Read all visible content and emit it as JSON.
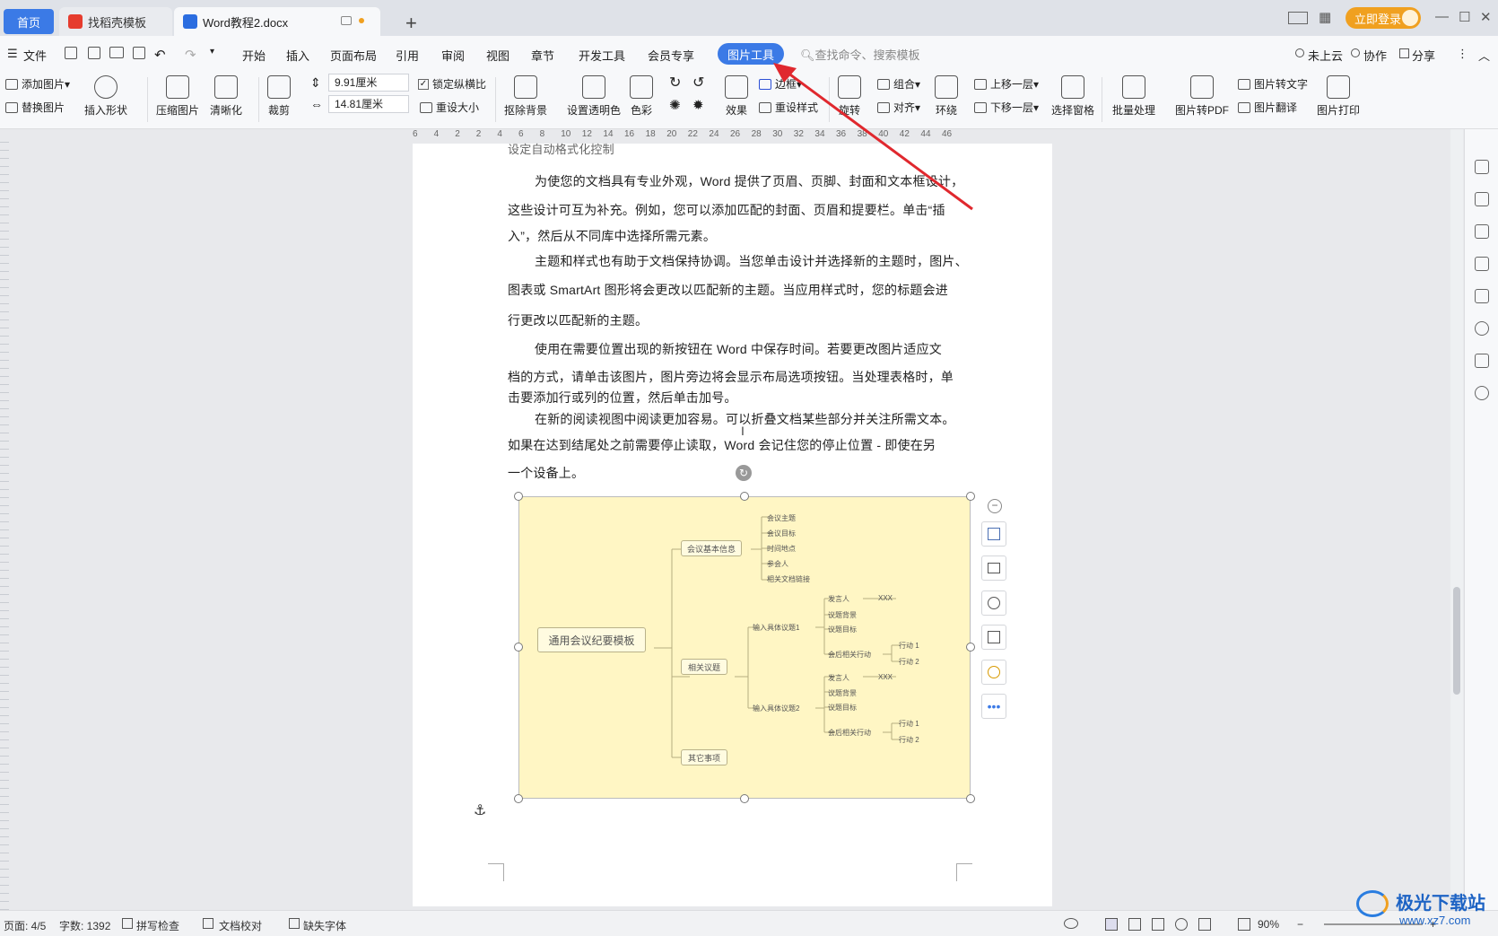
{
  "titlebar": {
    "tabs": [
      {
        "label": "首页"
      },
      {
        "label": "找稻壳模板"
      },
      {
        "label": "Word教程2.docx"
      }
    ],
    "login_label": "立即登录"
  },
  "menubar": {
    "file_label": "文件",
    "items": [
      "开始",
      "插入",
      "页面布局",
      "引用",
      "审阅",
      "视图",
      "章节",
      "开发工具",
      "会员专享"
    ],
    "active_tab": "图片工具",
    "search_placeholder": "查找命令、搜索模板",
    "right_items": [
      "未上云",
      "协作",
      "分享"
    ]
  },
  "ribbon": {
    "add_picture": "添加图片",
    "replace_picture": "替换图片",
    "insert_shape": "插入形状",
    "compress": "压缩图片",
    "sharpen": "清晰化",
    "crop": "裁剪",
    "width_value": "9.91厘米",
    "height_value": "14.81厘米",
    "lock_ratio": "锁定纵横比",
    "reset_size": "重设大小",
    "remove_bg": "抠除背景",
    "set_transparent": "设置透明色",
    "color": "色彩",
    "effects": "效果",
    "border": "边框",
    "reset_style": "重设样式",
    "rotate": "旋转",
    "group": "组合",
    "align": "对齐",
    "wrap": "环绕",
    "bring_forward": "上移一层",
    "send_backward": "下移一层",
    "selection_pane": "选择窗格",
    "batch": "批量处理",
    "to_pdf": "图片转PDF",
    "to_text": "图片转文字",
    "translate": "图片翻译",
    "print": "图片打印"
  },
  "ruler_ticks": [
    "6",
    "4",
    "2",
    "2",
    "4",
    "6",
    "8",
    "10",
    "12",
    "14",
    "16",
    "18",
    "20",
    "22",
    "24",
    "26",
    "28",
    "30",
    "32",
    "34",
    "36",
    "38",
    "40",
    "42",
    "44",
    "46"
  ],
  "document": {
    "partial_top": "设定自动格式化控制",
    "lines": [
      "为使您的文档具有专业外观，Word 提供了页眉、页脚、封面和文本框设计，",
      "这些设计可互为补充。例如，您可以添加匹配的封面、页眉和提要栏。单击“插",
      "入”，然后从不同库中选择所需元素。",
      "主题和样式也有助于文档保持协调。当您单击设计并选择新的主题时，图片、",
      "图表或 SmartArt 图形将会更改以匹配新的主题。当应用样式时，您的标题会进",
      "行更改以匹配新的主题。",
      "使用在需要位置出现的新按钮在 Word 中保存时间。若要更改图片适应文",
      "档的方式，请单击该图片，图片旁边将会显示布局选项按钮。当处理表格时，单",
      "击要添加行或列的位置，然后单击加号。",
      "在新的阅读视图中阅读更加容易。可以折叠文档某些部分并关注所需文本。",
      "如果在达到结尾处之前需要停止读取，Word 会记住您的停止位置 - 即使在另",
      "一个设备上。"
    ]
  },
  "mindmap": {
    "root": "通用会议纪要模板",
    "branch1": "会议基本信息",
    "branch1_items": [
      "会议主题",
      "会议目标",
      "时间地点",
      "参会人",
      "相关文档链接"
    ],
    "branch2": "相关议题",
    "topic1": "输入具体议题1",
    "topic2": "输入具体议题2",
    "speaker": "发言人",
    "xxx": "XXX",
    "background": "议题背景",
    "goal": "议题目标",
    "followup": "会后相关行动",
    "action1": "行动 1",
    "action2": "行动 2",
    "branch3": "其它事项"
  },
  "statusbar": {
    "page": "页面: 4/5",
    "words": "字数: 1392",
    "spell": "拼写检查",
    "proof": "文档校对",
    "missing_font": "缺失字体",
    "zoom": "90%"
  },
  "watermark": {
    "brand": "极光下载站",
    "url": "www.xz7.com"
  },
  "colors": {
    "accent": "#3b7ae6",
    "login": "#f0a020",
    "picture_bg": "#fff6c4",
    "arrow": "#e0282e"
  }
}
